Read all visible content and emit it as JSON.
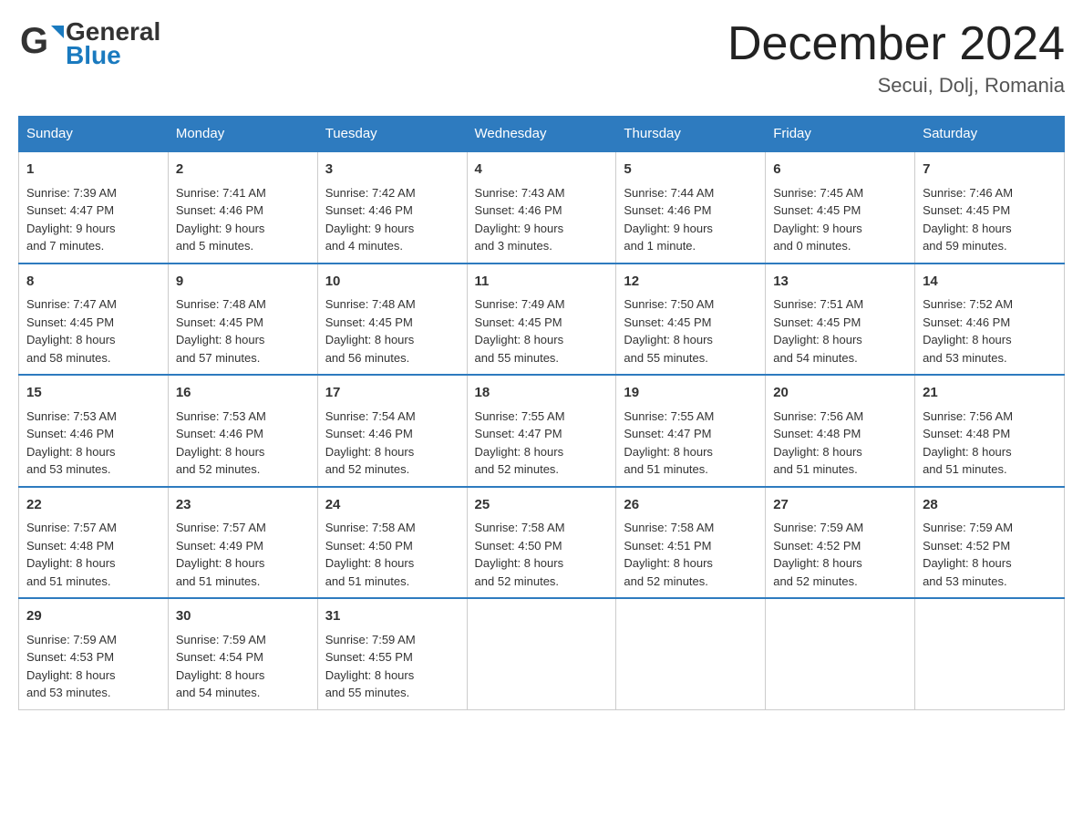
{
  "header": {
    "logo_general": "General",
    "logo_blue": "Blue",
    "title": "December 2024",
    "subtitle": "Secui, Dolj, Romania"
  },
  "days": [
    "Sunday",
    "Monday",
    "Tuesday",
    "Wednesday",
    "Thursday",
    "Friday",
    "Saturday"
  ],
  "weeks": [
    [
      {
        "day": "1",
        "sunrise": "7:39 AM",
        "sunset": "4:47 PM",
        "daylight": "9 hours and 7 minutes."
      },
      {
        "day": "2",
        "sunrise": "7:41 AM",
        "sunset": "4:46 PM",
        "daylight": "9 hours and 5 minutes."
      },
      {
        "day": "3",
        "sunrise": "7:42 AM",
        "sunset": "4:46 PM",
        "daylight": "9 hours and 4 minutes."
      },
      {
        "day": "4",
        "sunrise": "7:43 AM",
        "sunset": "4:46 PM",
        "daylight": "9 hours and 3 minutes."
      },
      {
        "day": "5",
        "sunrise": "7:44 AM",
        "sunset": "4:46 PM",
        "daylight": "9 hours and 1 minute."
      },
      {
        "day": "6",
        "sunrise": "7:45 AM",
        "sunset": "4:45 PM",
        "daylight": "9 hours and 0 minutes."
      },
      {
        "day": "7",
        "sunrise": "7:46 AM",
        "sunset": "4:45 PM",
        "daylight": "8 hours and 59 minutes."
      }
    ],
    [
      {
        "day": "8",
        "sunrise": "7:47 AM",
        "sunset": "4:45 PM",
        "daylight": "8 hours and 58 minutes."
      },
      {
        "day": "9",
        "sunrise": "7:48 AM",
        "sunset": "4:45 PM",
        "daylight": "8 hours and 57 minutes."
      },
      {
        "day": "10",
        "sunrise": "7:48 AM",
        "sunset": "4:45 PM",
        "daylight": "8 hours and 56 minutes."
      },
      {
        "day": "11",
        "sunrise": "7:49 AM",
        "sunset": "4:45 PM",
        "daylight": "8 hours and 55 minutes."
      },
      {
        "day": "12",
        "sunrise": "7:50 AM",
        "sunset": "4:45 PM",
        "daylight": "8 hours and 55 minutes."
      },
      {
        "day": "13",
        "sunrise": "7:51 AM",
        "sunset": "4:45 PM",
        "daylight": "8 hours and 54 minutes."
      },
      {
        "day": "14",
        "sunrise": "7:52 AM",
        "sunset": "4:46 PM",
        "daylight": "8 hours and 53 minutes."
      }
    ],
    [
      {
        "day": "15",
        "sunrise": "7:53 AM",
        "sunset": "4:46 PM",
        "daylight": "8 hours and 53 minutes."
      },
      {
        "day": "16",
        "sunrise": "7:53 AM",
        "sunset": "4:46 PM",
        "daylight": "8 hours and 52 minutes."
      },
      {
        "day": "17",
        "sunrise": "7:54 AM",
        "sunset": "4:46 PM",
        "daylight": "8 hours and 52 minutes."
      },
      {
        "day": "18",
        "sunrise": "7:55 AM",
        "sunset": "4:47 PM",
        "daylight": "8 hours and 52 minutes."
      },
      {
        "day": "19",
        "sunrise": "7:55 AM",
        "sunset": "4:47 PM",
        "daylight": "8 hours and 51 minutes."
      },
      {
        "day": "20",
        "sunrise": "7:56 AM",
        "sunset": "4:48 PM",
        "daylight": "8 hours and 51 minutes."
      },
      {
        "day": "21",
        "sunrise": "7:56 AM",
        "sunset": "4:48 PM",
        "daylight": "8 hours and 51 minutes."
      }
    ],
    [
      {
        "day": "22",
        "sunrise": "7:57 AM",
        "sunset": "4:48 PM",
        "daylight": "8 hours and 51 minutes."
      },
      {
        "day": "23",
        "sunrise": "7:57 AM",
        "sunset": "4:49 PM",
        "daylight": "8 hours and 51 minutes."
      },
      {
        "day": "24",
        "sunrise": "7:58 AM",
        "sunset": "4:50 PM",
        "daylight": "8 hours and 51 minutes."
      },
      {
        "day": "25",
        "sunrise": "7:58 AM",
        "sunset": "4:50 PM",
        "daylight": "8 hours and 52 minutes."
      },
      {
        "day": "26",
        "sunrise": "7:58 AM",
        "sunset": "4:51 PM",
        "daylight": "8 hours and 52 minutes."
      },
      {
        "day": "27",
        "sunrise": "7:59 AM",
        "sunset": "4:52 PM",
        "daylight": "8 hours and 52 minutes."
      },
      {
        "day": "28",
        "sunrise": "7:59 AM",
        "sunset": "4:52 PM",
        "daylight": "8 hours and 53 minutes."
      }
    ],
    [
      {
        "day": "29",
        "sunrise": "7:59 AM",
        "sunset": "4:53 PM",
        "daylight": "8 hours and 53 minutes."
      },
      {
        "day": "30",
        "sunrise": "7:59 AM",
        "sunset": "4:54 PM",
        "daylight": "8 hours and 54 minutes."
      },
      {
        "day": "31",
        "sunrise": "7:59 AM",
        "sunset": "4:55 PM",
        "daylight": "8 hours and 55 minutes."
      },
      null,
      null,
      null,
      null
    ]
  ]
}
